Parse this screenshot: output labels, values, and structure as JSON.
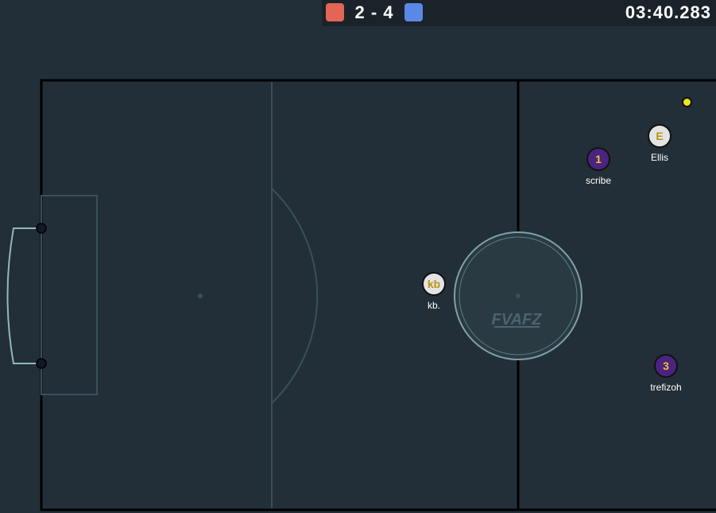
{
  "scoreboard": {
    "score": "2 - 4",
    "timer": "03:40.283",
    "red_color": "#e16655",
    "blue_color": "#5a89e5"
  },
  "field": {
    "logo_text": "FVAFZ",
    "line_color": "#000000",
    "marking_color": "#38505b",
    "goal_color": "#8fb8bc"
  },
  "players": [
    {
      "id": "kb",
      "avatar": "kb",
      "name": "kb.",
      "team": "red"
    },
    {
      "id": "ellis",
      "avatar": "E",
      "name": "Ellis",
      "team": "red"
    },
    {
      "id": "scribe",
      "avatar": "1",
      "name": "scribe",
      "team": "blue"
    },
    {
      "id": "trefizoh",
      "avatar": "3",
      "name": "trefizoh",
      "team": "blue"
    }
  ],
  "ball": {
    "color": "#e9e624"
  }
}
